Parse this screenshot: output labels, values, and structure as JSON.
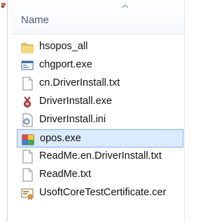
{
  "column": {
    "name_header": "Name"
  },
  "files": [
    {
      "name": "hsopos_all",
      "icon": "folder-icon",
      "selected": false
    },
    {
      "name": "chgport.exe",
      "icon": "application-window-icon",
      "selected": false
    },
    {
      "name": "cn.DriverInstall.txt",
      "icon": "text-document-icon",
      "selected": false
    },
    {
      "name": "DriverInstall.exe",
      "icon": "installer-exe-icon",
      "selected": false
    },
    {
      "name": "DriverInstall.ini",
      "icon": "config-settings-icon",
      "selected": false
    },
    {
      "name": "opos.exe",
      "icon": "opos-app-icon",
      "selected": true
    },
    {
      "name": "ReadMe.en.DriverInstall.txt",
      "icon": "text-document-icon",
      "selected": false
    },
    {
      "name": "ReadMe.txt",
      "icon": "text-document-icon",
      "selected": false
    },
    {
      "name": "UsoftCoreTestCertificate.cer",
      "icon": "certificate-icon",
      "selected": false
    }
  ],
  "colors": {
    "selection_fill": "#dbeafc",
    "selection_border": "#7eb4ea",
    "header_text": "#4c607a"
  }
}
